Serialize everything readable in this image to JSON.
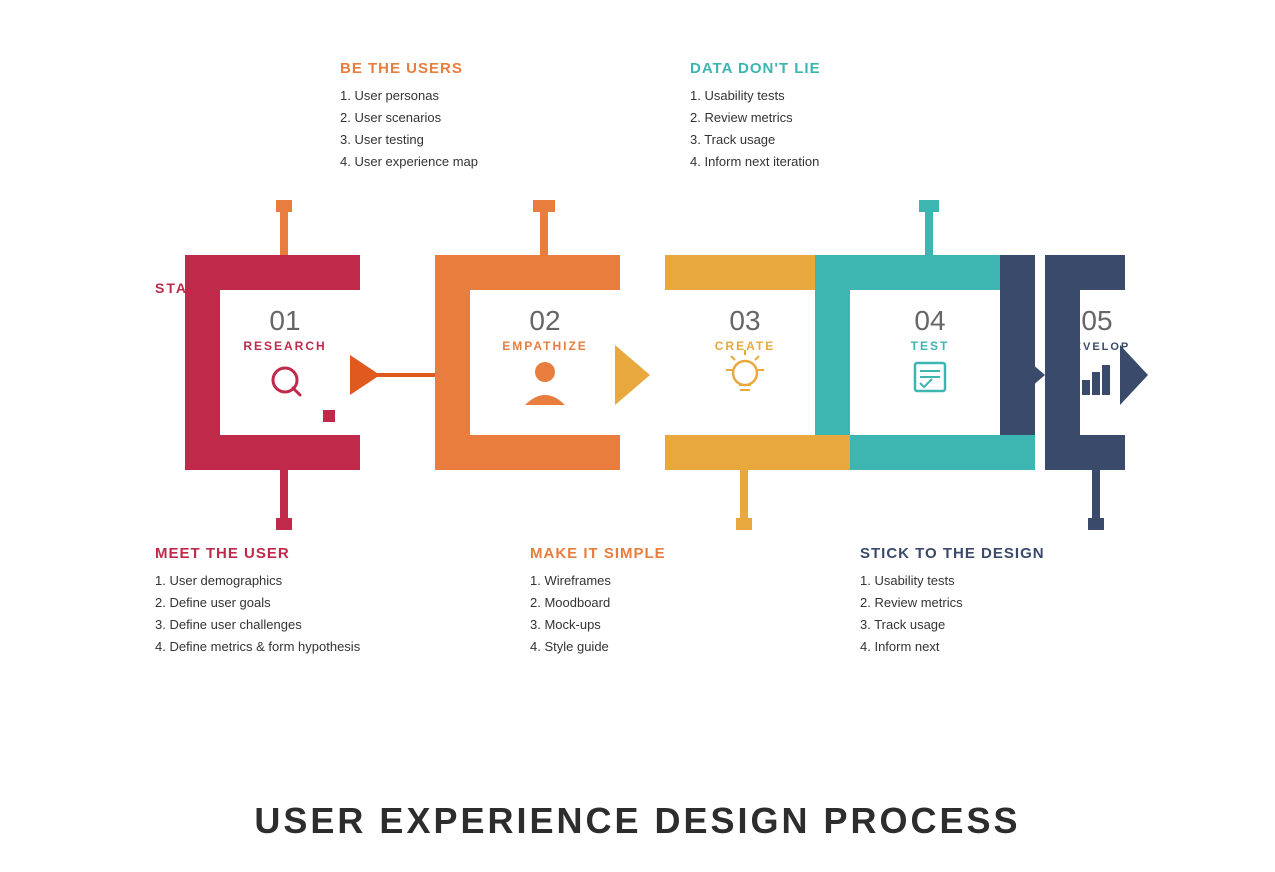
{
  "top_labels": {
    "empathize": {
      "title": "BE THE USERS",
      "color": "orange",
      "items": [
        "1. User personas",
        "2. User scenarios",
        "3. User testing",
        "4. User experience map"
      ]
    },
    "test": {
      "title": "DATA DON'T LIE",
      "color": "teal",
      "items": [
        "1. Usability tests",
        "2. Review metrics",
        "3. Track usage",
        "4. Inform next iteration"
      ]
    }
  },
  "bottom_labels": {
    "research": {
      "title": "MEET THE USER",
      "color": "crimson",
      "items": [
        "1. User demographics",
        "2. Define user goals",
        "3. Define user challenges",
        "4. Define metrics & form hypothesis"
      ]
    },
    "create": {
      "title": "MAKE  IT SIMPLE",
      "color": "orange2",
      "items": [
        "1. Wireframes",
        "2. Moodboard",
        "3. Mock-ups",
        "4. Style guide"
      ]
    },
    "develop": {
      "title": "STICK TO THE DESIGN",
      "color": "dark",
      "items": [
        "1. Usability tests",
        "2. Review metrics",
        "3. Track usage",
        "4. Inform next"
      ]
    }
  },
  "steps": [
    {
      "number": "01",
      "label": "RESEARCH",
      "color": "#c0294a",
      "icon": "🔍"
    },
    {
      "number": "02",
      "label": "EMPATHIZE",
      "color": "#e87d3e",
      "icon": "👤"
    },
    {
      "number": "03",
      "label": "CREATE",
      "color": "#e8a83e",
      "icon": "💡"
    },
    {
      "number": "04",
      "label": "TEST",
      "color": "#3db5b0",
      "icon": "📋"
    },
    {
      "number": "05",
      "label": "DEVELOP",
      "color": "#3a4a6b",
      "icon": "📊"
    }
  ],
  "start_label": "START",
  "footer_title": "USER EXPERIENCE DESIGN PROCESS"
}
